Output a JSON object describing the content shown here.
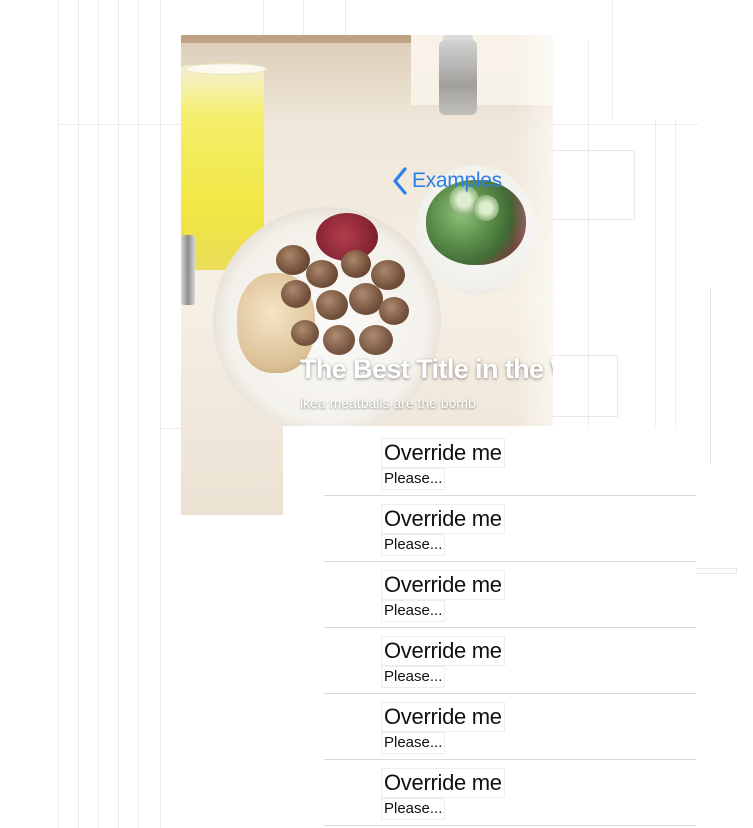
{
  "nav": {
    "back_label": "Examples"
  },
  "header": {
    "title": "The Best Title in the World",
    "subtitle": "ikea meatballs are the bomb"
  },
  "rows": [
    {
      "title": "Override me",
      "subtitle": "Please..."
    },
    {
      "title": "Override me",
      "subtitle": "Please..."
    },
    {
      "title": "Override me",
      "subtitle": "Please..."
    },
    {
      "title": "Override me",
      "subtitle": "Please..."
    },
    {
      "title": "Override me",
      "subtitle": "Please..."
    },
    {
      "title": "Override me",
      "subtitle": "Please..."
    }
  ],
  "colors": {
    "accent": "#2d7fe6",
    "separator": "#d9d9d9"
  },
  "icons": {
    "back": "chevron-left-icon"
  }
}
